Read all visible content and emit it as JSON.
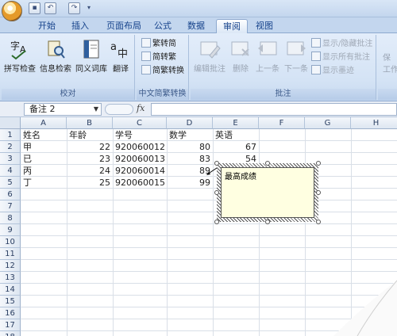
{
  "title_bar": {
    "quick_access": [
      "save",
      "undo",
      "redo"
    ]
  },
  "tabs": [
    {
      "label": "开始",
      "active": false
    },
    {
      "label": "插入",
      "active": false
    },
    {
      "label": "页面布局",
      "active": false
    },
    {
      "label": "公式",
      "active": false
    },
    {
      "label": "数据",
      "active": false
    },
    {
      "label": "审阅",
      "active": true
    },
    {
      "label": "视图",
      "active": false
    }
  ],
  "ribbon": {
    "proofing": {
      "label": "校对",
      "spell_check": "拼写检查",
      "research": "信息检索",
      "thesaurus": "同义词库",
      "translate": "翻译"
    },
    "chinese_conversion": {
      "label": "中文简繁转换",
      "to_simplified": "繁转简",
      "to_traditional": "简转繁",
      "convert": "简繁转换"
    },
    "comments": {
      "label": "批注",
      "edit_comment": "编辑批注",
      "delete": "删除",
      "previous": "上一条",
      "next": "下一条",
      "show_hide": "显示/隐藏批注",
      "show_all": "显示所有批注",
      "show_ink": "显示墨迹"
    },
    "changes": {
      "protect": "保",
      "workbook": "工作"
    }
  },
  "formula_bar": {
    "name_box": "备注 2",
    "fx": "fx",
    "content": ""
  },
  "sheet": {
    "columns": [
      "A",
      "B",
      "C",
      "D",
      "E",
      "F",
      "G",
      "H"
    ],
    "rows": [
      "1",
      "2",
      "3",
      "4",
      "5",
      "6",
      "7",
      "8",
      "9",
      "10",
      "11",
      "12",
      "13",
      "14",
      "15",
      "16",
      "17",
      "18"
    ],
    "headers": [
      "姓名",
      "年龄",
      "学号",
      "数学",
      "英语"
    ],
    "data": [
      {
        "name": "甲",
        "age": "22",
        "id": "920060012",
        "math": "80",
        "english": "67"
      },
      {
        "name": "已",
        "age": "23",
        "id": "920060013",
        "math": "83",
        "english": "54"
      },
      {
        "name": "丙",
        "age": "24",
        "id": "920060014",
        "math": "89",
        "english": ""
      },
      {
        "name": "丁",
        "age": "25",
        "id": "920060015",
        "math": "99",
        "english": ""
      }
    ]
  },
  "comment": {
    "text": "最高成绩",
    "fill": "#ffffe1"
  },
  "colors": {
    "ribbon_text": "#15428b",
    "accent": "#c3d6ee"
  }
}
